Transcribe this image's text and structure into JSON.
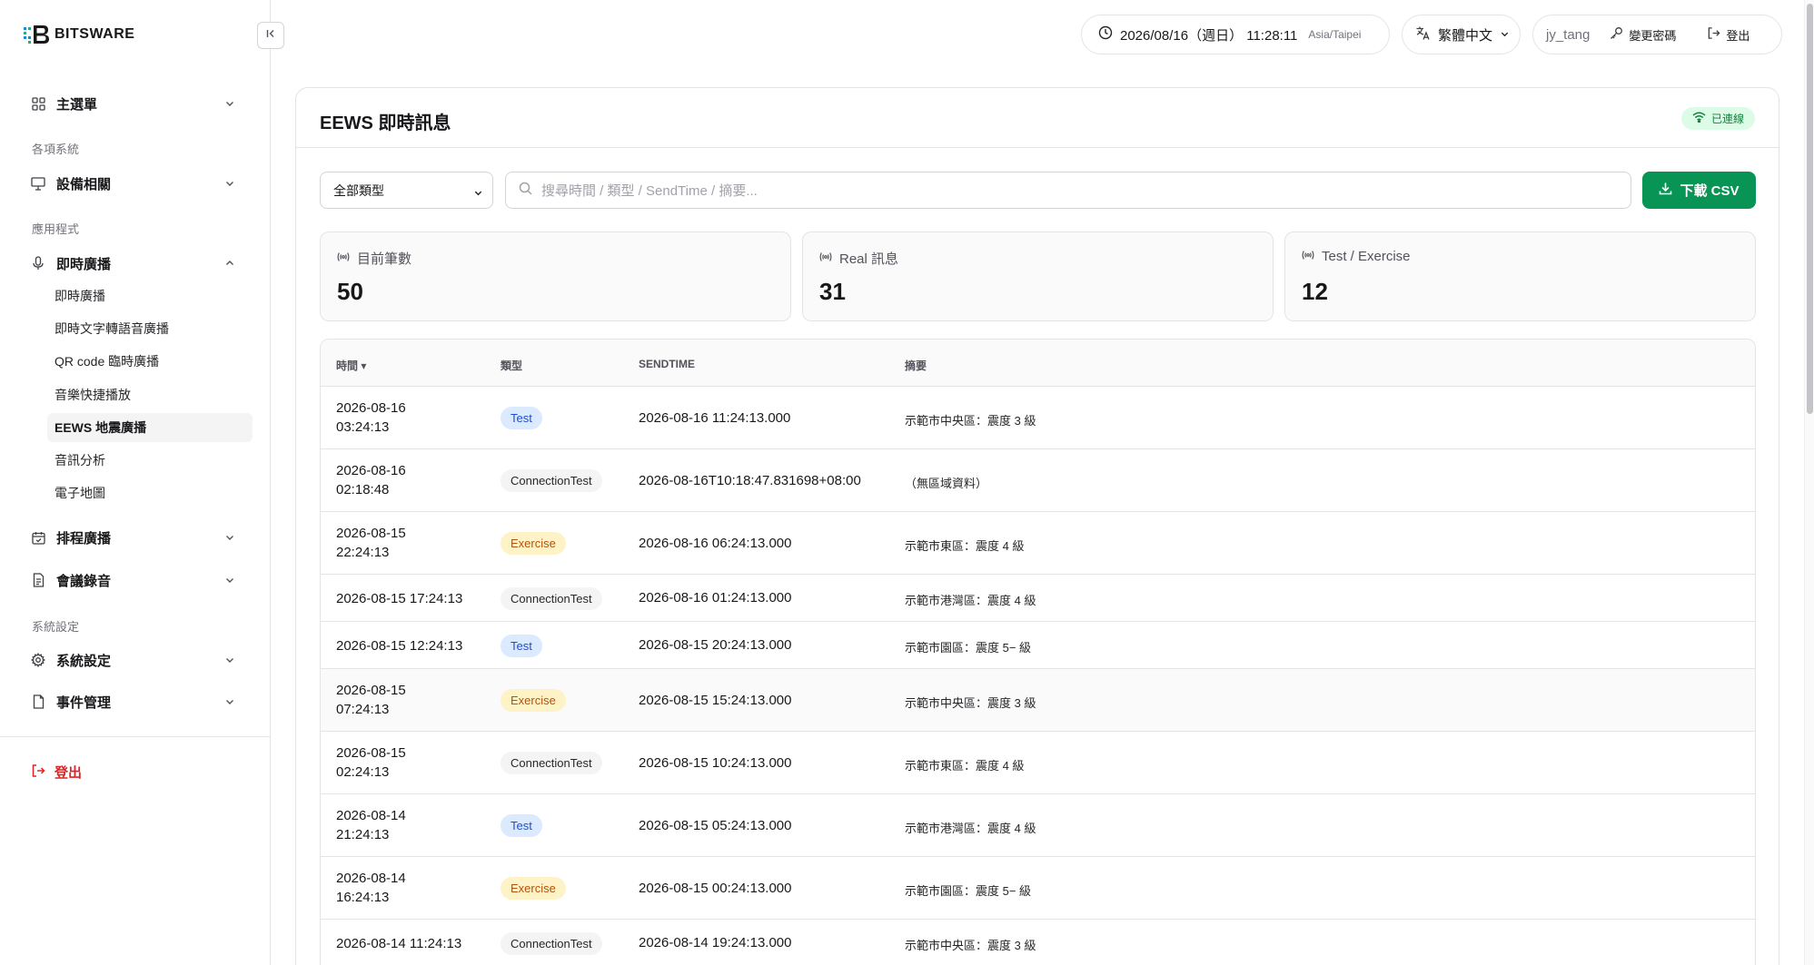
{
  "brand": {
    "name": "BITSWARE"
  },
  "sidebar": {
    "main_menu": "主選單",
    "sections": [
      "各項系統",
      "應用程式",
      "系統設定"
    ],
    "groups": {
      "devices": "設備相關",
      "live": "即時廣播",
      "schedule": "排程廣播",
      "meeting": "會議錄音",
      "settings": "系統設定",
      "events": "事件管理"
    },
    "live_items": [
      "即時廣播",
      "即時文字轉語音廣播",
      "QR code 臨時廣播",
      "音樂快捷播放",
      "EEWS 地震廣播",
      "音訊分析",
      "電子地圖"
    ],
    "logout": "登出"
  },
  "topbar": {
    "datetime": "2026/08/16（週日） 11:28:11",
    "timezone": "Asia/Taipei",
    "language": "繁體中文",
    "username": "jy_tang",
    "change_password": "變更密碼",
    "logout": "登出"
  },
  "page": {
    "title": "EEWS 即時訊息",
    "status": "已連線",
    "filter": {
      "selected": "全部類型"
    },
    "search_placeholder": "搜尋時間 / 類型 / SendTime / 摘要...",
    "download_label": "下載 CSV"
  },
  "stats": [
    {
      "label": "目前筆數",
      "value": "50"
    },
    {
      "label": "Real 訊息",
      "value": "31"
    },
    {
      "label": "Test / Exercise",
      "value": "12"
    }
  ],
  "table": {
    "headers": {
      "time": "時間 ▾",
      "type": "類型",
      "sendtime": "SENDTIME",
      "summary": "摘要"
    },
    "rows": [
      {
        "time": "2026-08-16\n03:24:13",
        "type": "Test",
        "kind": "test",
        "sendtime": "2026-08-16 11:24:13.000",
        "summary": "示範市中央區：震度 3 級"
      },
      {
        "time": "2026-08-16\n02:18:48",
        "type": "ConnectionTest",
        "kind": "conn",
        "sendtime": "2026-08-16T10:18:47.831698+08:00",
        "summary": "（無區域資料）"
      },
      {
        "time": "2026-08-15\n22:24:13",
        "type": "Exercise",
        "kind": "exer",
        "sendtime": "2026-08-16 06:24:13.000",
        "summary": "示範市東區：震度 4 級"
      },
      {
        "time": "2026-08-15 17:24:13",
        "type": "ConnectionTest",
        "kind": "conn",
        "sendtime": "2026-08-16 01:24:13.000",
        "summary": "示範市港灣區：震度 4 級"
      },
      {
        "time": "2026-08-15 12:24:13",
        "type": "Test",
        "kind": "test",
        "sendtime": "2026-08-15 20:24:13.000",
        "summary": "示範市園區：震度 5− 級"
      },
      {
        "time": "2026-08-15\n07:24:13",
        "type": "Exercise",
        "kind": "exer",
        "sendtime": "2026-08-15 15:24:13.000",
        "summary": "示範市中央區：震度 3 級"
      },
      {
        "time": "2026-08-15\n02:24:13",
        "type": "ConnectionTest",
        "kind": "conn",
        "sendtime": "2026-08-15 10:24:13.000",
        "summary": "示範市東區：震度 4 級"
      },
      {
        "time": "2026-08-14\n21:24:13",
        "type": "Test",
        "kind": "test",
        "sendtime": "2026-08-15 05:24:13.000",
        "summary": "示範市港灣區：震度 4 級"
      },
      {
        "time": "2026-08-14\n16:24:13",
        "type": "Exercise",
        "kind": "exer",
        "sendtime": "2026-08-15 00:24:13.000",
        "summary": "示範市園區：震度 5− 級"
      },
      {
        "time": "2026-08-14 11:24:13",
        "type": "ConnectionTest",
        "kind": "conn",
        "sendtime": "2026-08-14 19:24:13.000",
        "summary": "示範市中央區：震度 3 級"
      }
    ]
  },
  "colors": {
    "accent": "#079455",
    "danger": "#dc2626",
    "connected_bg": "#dcfce7",
    "connected_fg": "#15803d"
  }
}
